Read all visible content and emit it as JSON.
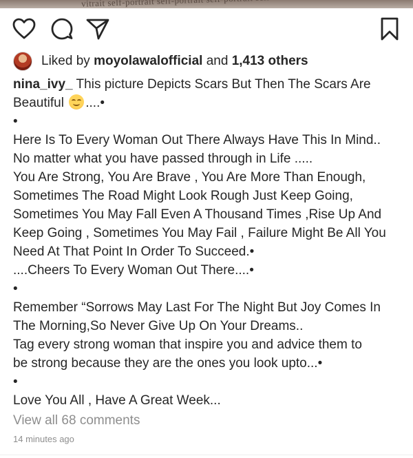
{
  "photo": {
    "imprint_text": "vitrait self-portrait self-portrait self-portrait self"
  },
  "actions": {
    "like_icon": "heart-icon",
    "comment_icon": "comment-icon",
    "share_icon": "paper-plane-icon",
    "save_icon": "bookmark-icon"
  },
  "likes": {
    "prefix": "Liked by",
    "user": "moyolawalofficial",
    "conjunction": "and",
    "others": "1,413 others"
  },
  "caption": {
    "username": "nina_ivy_",
    "lines": [
      "This picture Depicts  Scars But Then The Scars Are",
      "Beautiful",
      "....•",
      "•",
      "Here Is To Every Woman  Out There Always Have This In Mind..",
      "No matter what you have passed through in Life .....",
      "You Are Strong, You Are Brave , You Are More Than Enough,",
      "Sometimes The Road Might Look Rough Just Keep Going,",
      "Sometimes You May Fall Even A Thousand Times ,Rise Up And",
      "Keep Going , Sometimes You May Fail , Failure Might Be All You",
      "Need At That Point In Order To Succeed.•",
      "....Cheers To Every Woman Out There....•",
      "•",
      "Remember “Sorrows May Last For The Night But Joy Comes In",
      "The Morning,So Never Give Up On Your Dreams..",
      "Tag every strong woman that inspire you and advice them to",
      "be strong because they are the ones you look upto...•",
      "•",
      "Love You All , Have A Great Week..."
    ],
    "emoji": "smiling-face-emoji"
  },
  "view_comments": "View all 68 comments",
  "timestamp": "14 minutes ago"
}
